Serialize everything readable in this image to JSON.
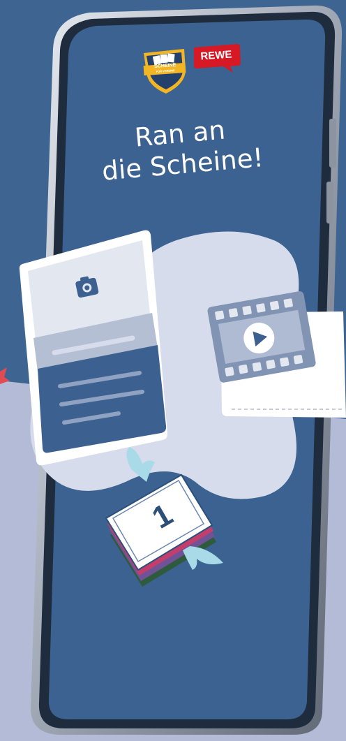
{
  "headline": {
    "line1": "Ran an",
    "line2": "die Scheine!"
  },
  "logos": {
    "rewe": "REWE",
    "sfv_line1": "SCHEINE",
    "sfv_line2": "FÜR VEREINE"
  },
  "bill_number": "1",
  "colors": {
    "background_top": "#3e6592",
    "background_bottom": "#b3bbd6",
    "screen": "#3b6290",
    "blob": "#d6dceb",
    "rewe_red": "#d61924",
    "card_dark": "#3c6190"
  },
  "icons": [
    "camera-icon",
    "play-icon",
    "film-strip-icon",
    "money-bill-icon",
    "wing-icon"
  ]
}
